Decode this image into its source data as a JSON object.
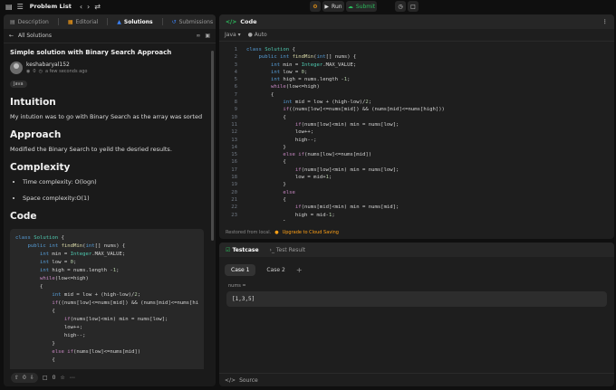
{
  "topbar": {
    "title": "Problem List",
    "run_label": "Run",
    "submit_label": "Submit"
  },
  "left": {
    "tabs": [
      {
        "label": "Description"
      },
      {
        "label": "Editorial"
      },
      {
        "label": "Solutions"
      },
      {
        "label": "Submissions"
      }
    ],
    "back_label": "All Solutions",
    "solution_title": "Simple solution with Binary Search Approach",
    "author": "keshabaryal152",
    "views": "0",
    "time_ago": "a few seconds ago",
    "tag": "Java",
    "intuition_heading": "Intuition",
    "intuition_text": "My intution was to go with Binary Search as the array was sorted",
    "approach_heading": "Approach",
    "approach_text": "Modified the Binary Search to yeild the desried results.",
    "complexity_heading": "Complexity",
    "time_complexity": "Time complexity: O(logn)",
    "space_complexity": "Space complexity:O(1)",
    "code_heading": "Code",
    "upvotes": "0",
    "comments": "0"
  },
  "code": {
    "header": "Code",
    "language": "Java",
    "mode": "Auto",
    "saved_text": "Restored from local.",
    "upgrade_text": "Upgrade to Cloud Saving",
    "line_numbers": [
      "1",
      "2",
      "3",
      "4",
      "5",
      "6",
      "7",
      "8",
      "9",
      "10",
      "11",
      "12",
      "13",
      "14",
      "15",
      "16",
      "17",
      "18",
      "19",
      "20",
      "21",
      "22",
      "23"
    ]
  },
  "testcase": {
    "tab_label": "Testcase",
    "result_label": "Test Result",
    "case1": "Case 1",
    "case2": "Case 2",
    "var_label": "nums =",
    "value": "[1,3,5]",
    "source_label": "Source"
  }
}
